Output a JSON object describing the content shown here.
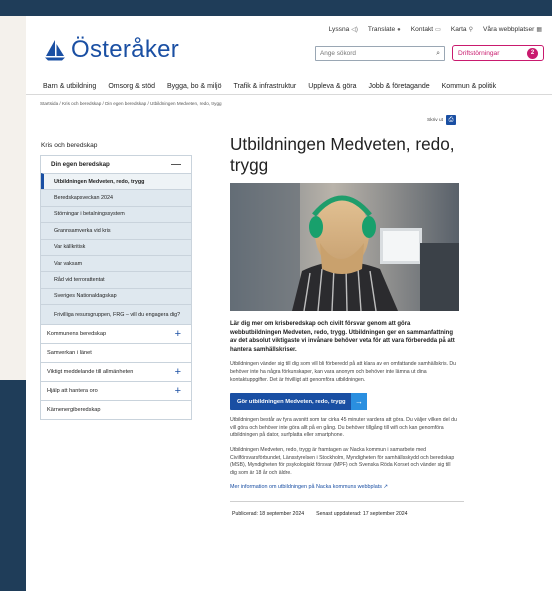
{
  "utility": {
    "items": [
      {
        "label": "Lyssna",
        "icon": "speaker-icon"
      },
      {
        "label": "Translate",
        "icon": "globe-icon"
      },
      {
        "label": "Kontakt",
        "icon": "chat-icon"
      },
      {
        "label": "Karta",
        "icon": "pin-icon"
      },
      {
        "label": "Våra webbplatser",
        "icon": "grid-icon"
      }
    ]
  },
  "brand": {
    "name": "Österåker",
    "color": "#1a4fa3"
  },
  "search": {
    "placeholder": "Ange sökord"
  },
  "status": {
    "label": "Driftstörningar",
    "count": "2",
    "color": "#c91a6e"
  },
  "nav": {
    "items": [
      "Barn & utbildning",
      "Omsorg & stöd",
      "Bygga, bo & miljö",
      "Trafik & infrastruktur",
      "Uppleva & göra",
      "Jobb & företagande",
      "Kommun & politik"
    ]
  },
  "breadcrumb": "Startsida  /  Kris och beredskap  /  Din egen beredskap  /  Utbildningen Medveten, redo, trygg",
  "share": {
    "label": "Skriv ut"
  },
  "sidebar": {
    "title": "Kris och beredskap",
    "section": "Din egen beredskap",
    "subitems": [
      "Utbildningen Medveten, redo, trygg",
      "Beredskapsveckan 2024",
      "Störningar i betalningssystem",
      "Grannsamverka vid kris",
      "Var källkritisk",
      "Var vaksam",
      "Råd vid terrorattentat",
      "Sveriges Nationaldagskap",
      "Frivilliga resursgruppen, FRG – vill du engagera dig?"
    ],
    "top": [
      {
        "label": "Kommunens beredskap",
        "expandable": true
      },
      {
        "label": "Samverkan i länet",
        "expandable": false
      },
      {
        "label": "Viktigt meddelande till allmänheten",
        "expandable": true
      },
      {
        "label": "Hjälp att hantera oro",
        "expandable": true
      },
      {
        "label": "Kärnenergiberedskap",
        "expandable": false
      }
    ]
  },
  "article": {
    "title": "Utbildningen Medveten, redo, trygg",
    "lead": "Lär dig mer om krisberedskap och civilt försvar genom att göra webbutbildningen Medveten, redo, trygg. Utbildningen ger en sammanfattning av det absolut viktigaste vi invånare behöver veta för att vara förberedda på att hantera samhällskriser.",
    "p1": "Utbildningen vänder sig till dig som vill bli förberedd på att klara av en omfattande samhällskris. Du behöver inte ha några förkunskaper, kan vara anonym och behöver inte lämna ut dina kontaktuppgifter. Det är frivilligt att genomföra utbildningen.",
    "cta": "Gör utbildningen Medveten, redo, trygg",
    "p2": "Utbildningen består av fyra avsnitt som tar cirka 45 minuter vardera att göra. Du väljer vilken del du vill göra och behöver inte göra allt på en gång. Du behöver tillgång till wifi och kan genomföra utbildningen på dator, surfplatta eller smartphone.",
    "p3": "Utbildningen Medveten, redo, trygg är framtagen av Nacka kommun i samarbete med Civilförsvarsförbundet, Länsstyrelsen i Stockholm, Myndigheten för samhällsskydd och beredskap (MSB), Myndigheten för psykologiskt försvar (MPF) och Svenska Röda Korset och vänder sig till dig som är 18 år och äldre.",
    "link": "Mer information om utbildningen på Nacka kommuns webbplats",
    "published": "Publicerad: 18 september 2024",
    "updated": "Senast uppdaterad: 17 september 2024"
  }
}
